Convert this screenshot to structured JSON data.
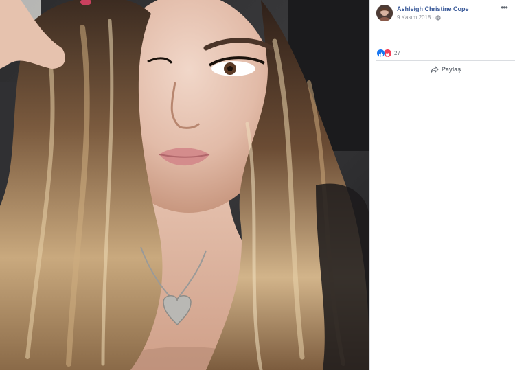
{
  "post": {
    "author_name": "Ashleigh Christine Cope",
    "date": "9 Kasım 2018",
    "meta_separator": "·",
    "privacy_icon": "globe-icon",
    "more_label": "•••",
    "avatar_icon": "avatar"
  },
  "reactions": {
    "icons": [
      "like-icon",
      "love-icon"
    ],
    "count": "27"
  },
  "actions": {
    "share_label": "Paylaş",
    "share_icon": "share-arrow-icon"
  },
  "colors": {
    "author_link": "#385898",
    "meta_text": "#90949c",
    "like_blue": "#1877f2",
    "love_red": "#f33e58",
    "photo_background": "#000000"
  }
}
